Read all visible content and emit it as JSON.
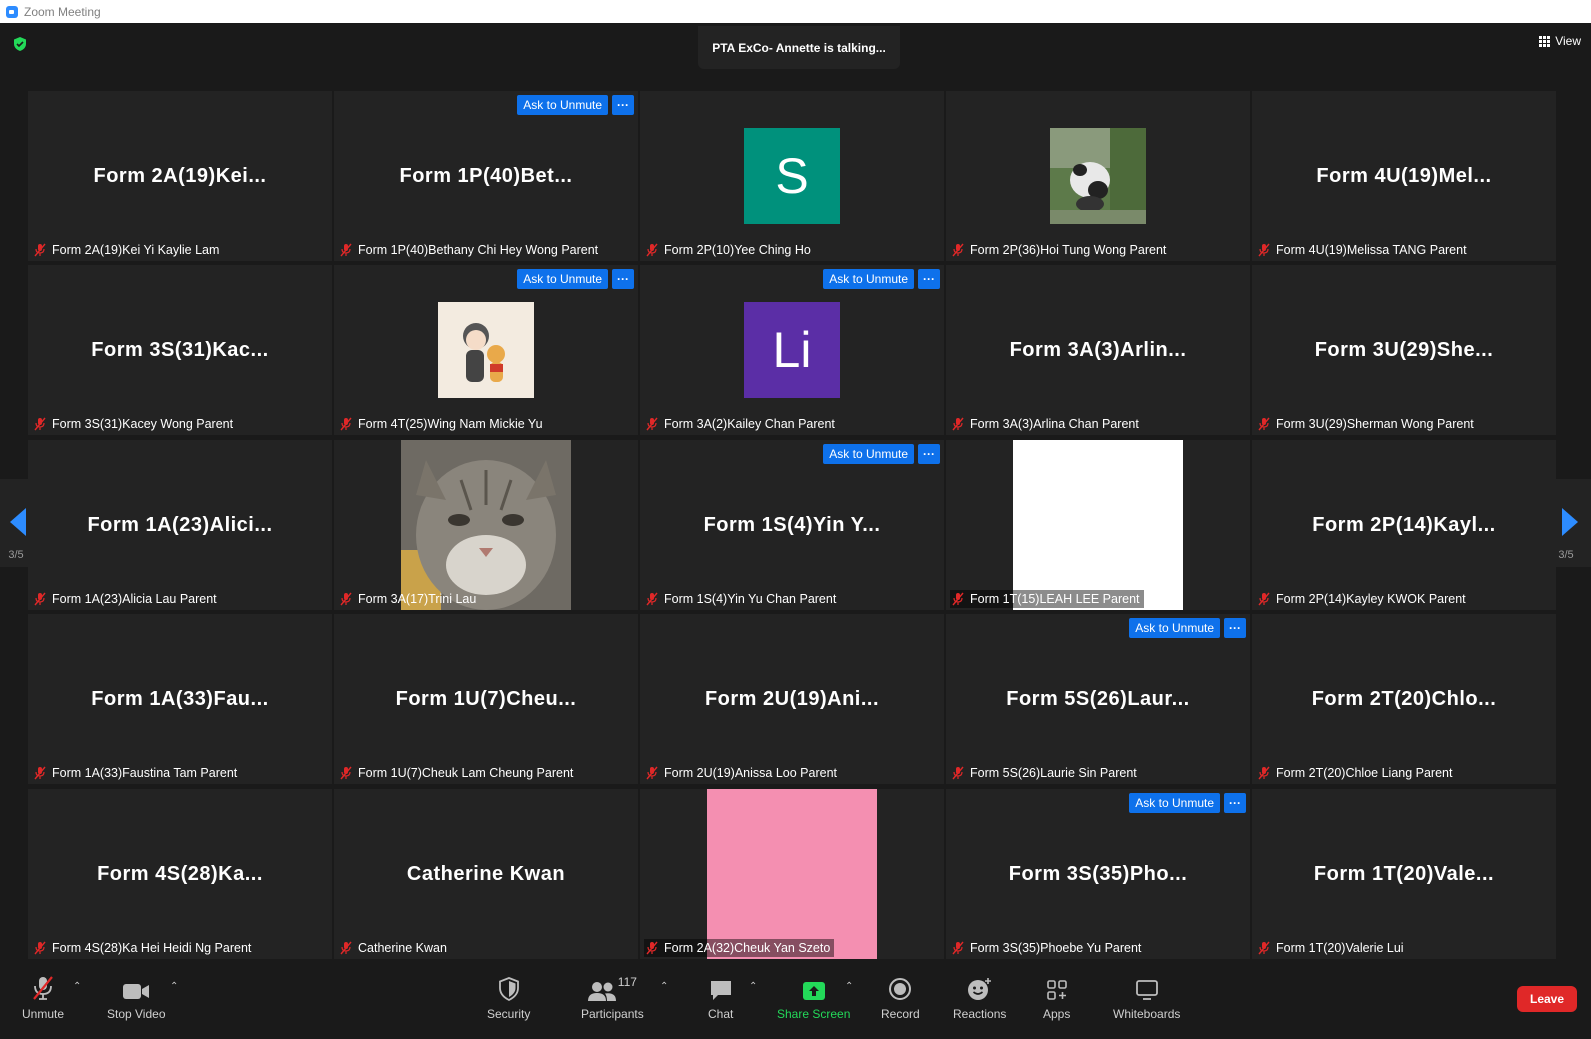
{
  "window": {
    "title": "Zoom Meeting"
  },
  "header": {
    "talking": "PTA ExCo- Annette is talking...",
    "view_label": "View"
  },
  "participant_action": {
    "ask_label": "Ask to Unmute",
    "more_label": "···"
  },
  "pager": {
    "page": "3/5"
  },
  "tiles": [
    {
      "display": "Form  2A(19)Kei...",
      "label": "Form 2A(19)Kei Yi Kaylie Lam"
    },
    {
      "display": "Form  1P(40)Bet...",
      "label": "Form 1P(40)Bethany Chi Hey Wong Parent"
    },
    {
      "display": "S",
      "label": "Form 2P(10)Yee Ching Ho"
    },
    {
      "display": "",
      "label": "Form 2P(36)Hoi Tung Wong Parent"
    },
    {
      "display": "Form  4U(19)Mel...",
      "label": "Form 4U(19)Melissa TANG Parent"
    },
    {
      "display": "Form  3S(31)Kac...",
      "label": "Form 3S(31)Kacey Wong Parent"
    },
    {
      "display": "",
      "label": "Form 4T(25)Wing Nam Mickie Yu"
    },
    {
      "display": "Li",
      "label": "Form 3A(2)Kailey Chan Parent"
    },
    {
      "display": "Form  3A(3)Arlin...",
      "label": "Form 3A(3)Arlina Chan Parent"
    },
    {
      "display": "Form  3U(29)She...",
      "label": "Form 3U(29)Sherman Wong Parent"
    },
    {
      "display": "Form  1A(23)Alici...",
      "label": "Form 1A(23)Alicia Lau Parent"
    },
    {
      "display": "",
      "label": "Form 3A(17)Trini Lau"
    },
    {
      "display": "Form  1S(4)Yin Y...",
      "label": "Form 1S(4)Yin Yu Chan Parent"
    },
    {
      "display": "",
      "label": "Form 1T(15)LEAH LEE Parent"
    },
    {
      "display": "Form  2P(14)Kayl...",
      "label": "Form 2P(14)Kayley KWOK Parent"
    },
    {
      "display": "Form  1A(33)Fau...",
      "label": "Form 1A(33)Faustina Tam Parent"
    },
    {
      "display": "Form  1U(7)Cheu...",
      "label": "Form 1U(7)Cheuk Lam Cheung Parent"
    },
    {
      "display": "Form  2U(19)Ani...",
      "label": "Form 2U(19)Anissa Loo Parent"
    },
    {
      "display": "Form  5S(26)Laur...",
      "label": "Form 5S(26)Laurie Sin Parent"
    },
    {
      "display": "Form  2T(20)Chlo...",
      "label": "Form 2T(20)Chloe Liang Parent"
    },
    {
      "display": "Form  4S(28)Ka...",
      "label": "Form 4S(28)Ka Hei Heidi Ng Parent"
    },
    {
      "display": "Catherine Kwan",
      "label": "Catherine Kwan"
    },
    {
      "display": "",
      "label": "Form 2A(32)Cheuk Yan Szeto"
    },
    {
      "display": "Form  3S(35)Pho...",
      "label": "Form 3S(35)Phoebe Yu Parent"
    },
    {
      "display": "Form  1T(20)Vale...",
      "label": "Form 1T(20)Valerie Lui"
    }
  ],
  "toolbar": {
    "unmute": "Unmute",
    "stop_video": "Stop Video",
    "security": "Security",
    "participants": "Participants",
    "participants_count": "117",
    "chat": "Chat",
    "share_screen": "Share Screen",
    "record": "Record",
    "reactions": "Reactions",
    "apps": "Apps",
    "whiteboards": "Whiteboards",
    "leave": "Leave"
  },
  "colors": {
    "accent_blue": "#0e71eb",
    "tile_bg": "#232323",
    "share_green": "#23d959",
    "leave_red": "#e02828",
    "avatar_s": "#00917c",
    "avatar_li": "#5b2ea6"
  }
}
